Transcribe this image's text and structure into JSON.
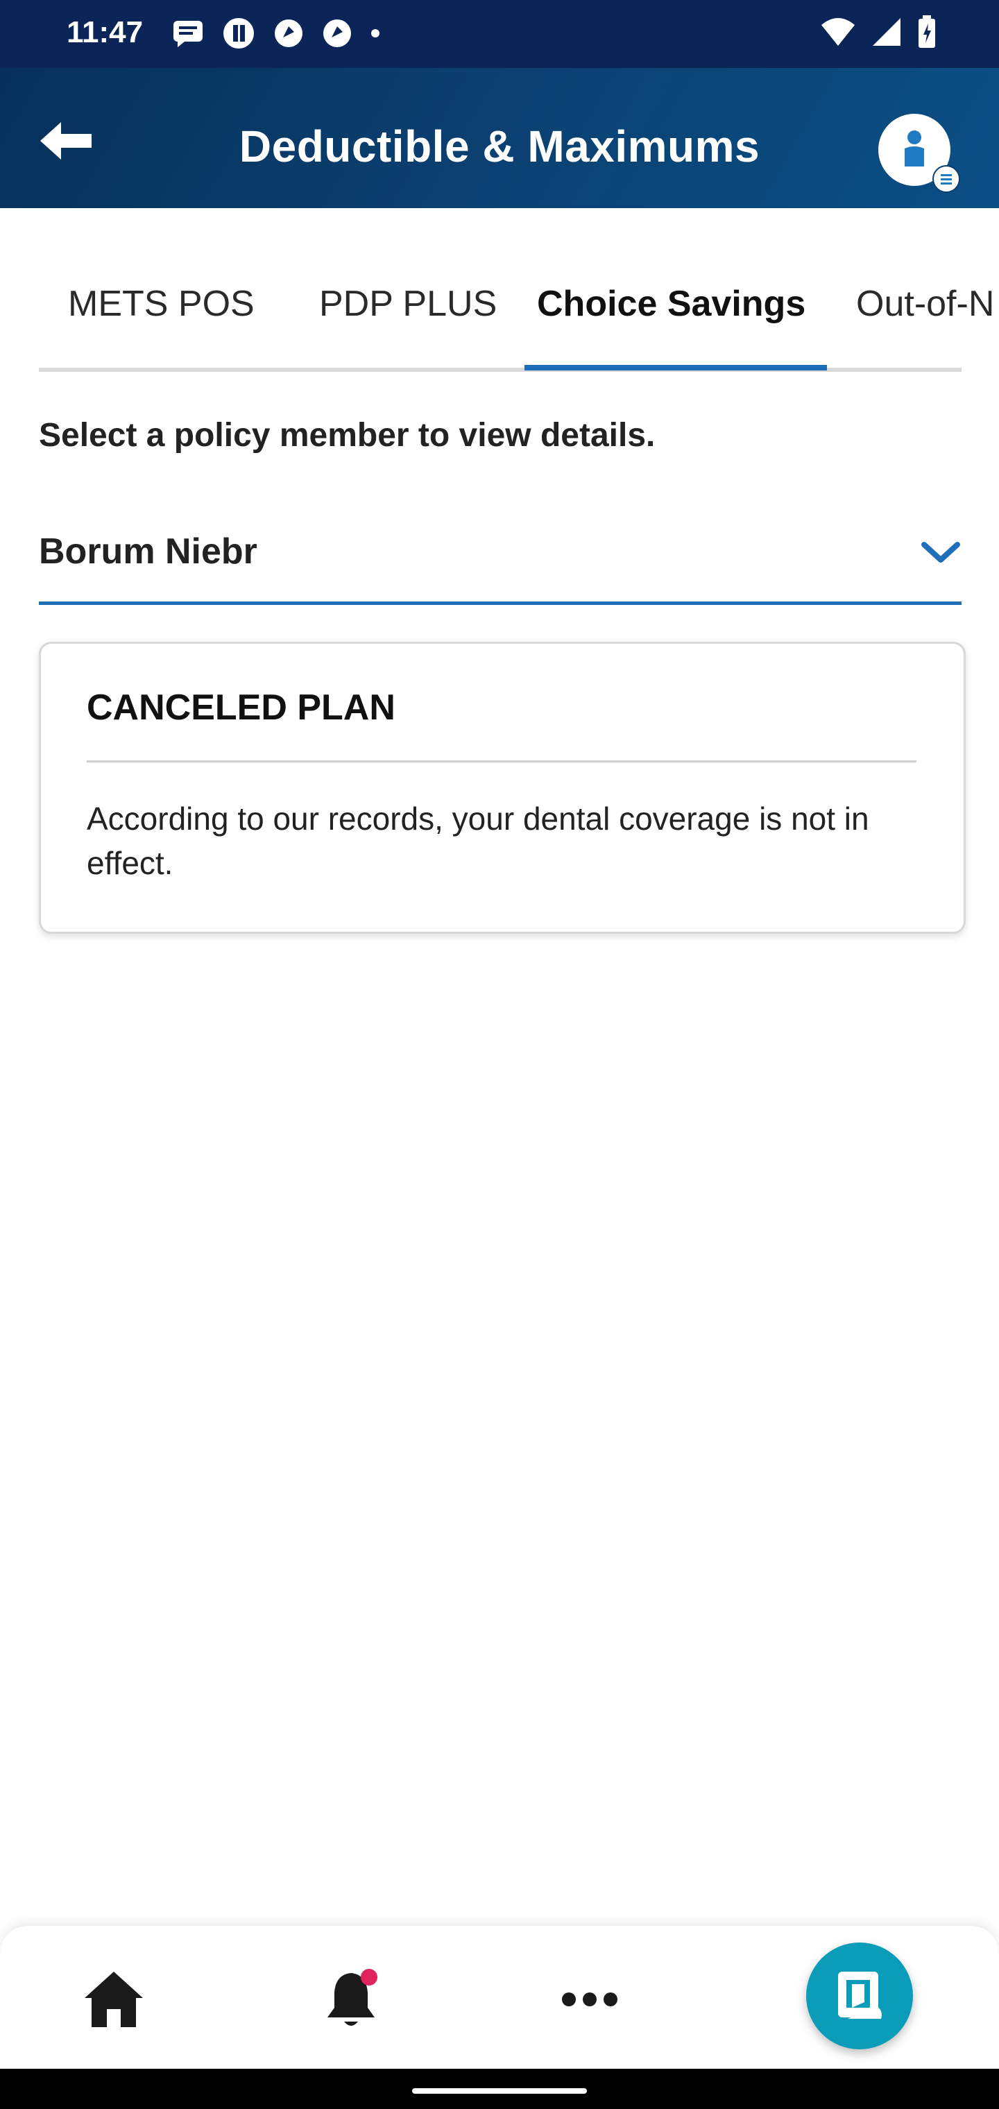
{
  "status_bar": {
    "time": "11:47"
  },
  "header": {
    "title": "Deductible & Maximums"
  },
  "tabs": [
    {
      "label": "METS POS",
      "active": false
    },
    {
      "label": "PDP PLUS",
      "active": false
    },
    {
      "label": "Choice Savings",
      "active": true
    },
    {
      "label": "Out-of-N",
      "active": false
    }
  ],
  "member_select": {
    "prompt": "Select a policy member to view details.",
    "selected": "Borum Niebr"
  },
  "card": {
    "title": "CANCELED PLAN",
    "body": "According to our records, your dental coverage is not in effect."
  },
  "colors": {
    "accent": "#1f6fb8",
    "header": "#0b3f6f",
    "fab": "#0a9cb8",
    "notification_dot": "#e0245e"
  }
}
